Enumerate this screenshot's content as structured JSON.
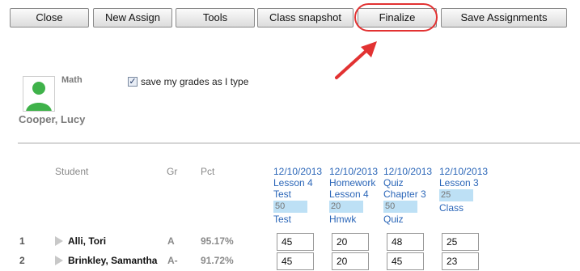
{
  "toolbar": {
    "buttons": [
      "Close",
      "New Assign",
      "Tools",
      "Class snapshot",
      "Finalize",
      "Save Assignments"
    ]
  },
  "header": {
    "subject": "Math",
    "save_checkbox_label": "save my grades as I type",
    "save_checkbox_checked": true,
    "student_name": "Cooper, Lucy",
    "avatar_icon": "user-silhouette-icon",
    "highlight_color": "#e23232",
    "accent_color": "#2b66b8"
  },
  "table": {
    "headers": {
      "student": "Student",
      "grade": "Gr",
      "pct": "Pct"
    },
    "assignments": [
      {
        "date": "12/10/2013",
        "line1": "Lesson 4",
        "line2": "Test",
        "points": "50",
        "type": "Test"
      },
      {
        "date": "12/10/2013",
        "line1": "Homework",
        "line2": "Lesson 4",
        "points": "20",
        "type": "Hmwk"
      },
      {
        "date": "12/10/2013",
        "line1": "Quiz",
        "line2": "Chapter 3",
        "points": "50",
        "type": "Quiz"
      },
      {
        "date": "12/10/2013",
        "line1": "Lesson 3",
        "line2": "",
        "points": "25",
        "type": "Class"
      }
    ],
    "rows": [
      {
        "num": "1",
        "name": "Alli, Tori",
        "grade": "A",
        "pct": "95.17%",
        "scores": [
          "45",
          "20",
          "48",
          "25"
        ]
      },
      {
        "num": "2",
        "name": "Brinkley, Samantha",
        "grade": "A-",
        "pct": "91.72%",
        "scores": [
          "45",
          "20",
          "45",
          "23"
        ]
      }
    ]
  }
}
